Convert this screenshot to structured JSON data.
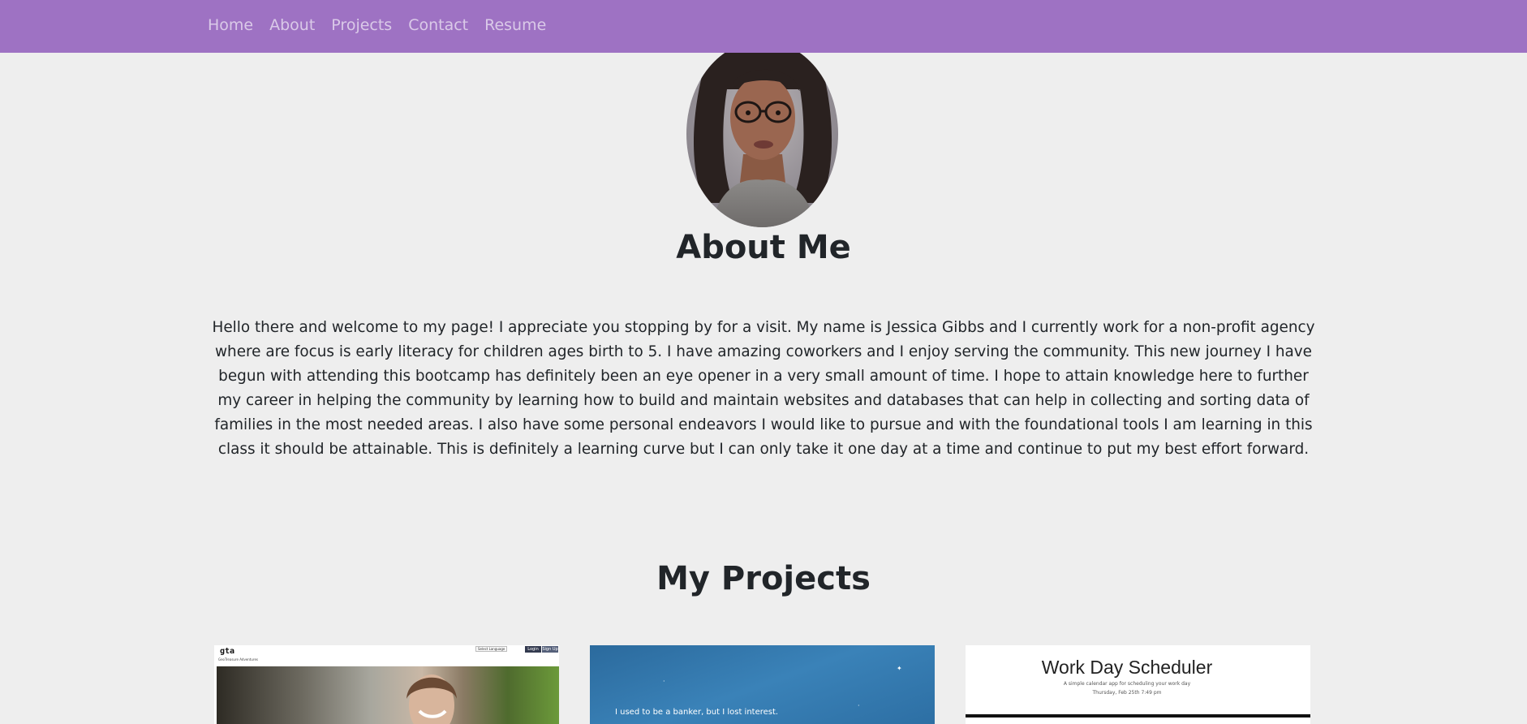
{
  "nav": {
    "items": [
      {
        "label": "Home"
      },
      {
        "label": "About"
      },
      {
        "label": "Projects"
      },
      {
        "label": "Contact"
      },
      {
        "label": "Resume"
      }
    ]
  },
  "colors": {
    "navbar": "#9e72c3",
    "background": "#eeeeee",
    "heading": "#212529"
  },
  "about": {
    "title": "About Me",
    "text": "Hello there and welcome to my page! I appreciate you stopping by for a visit. My name is Jessica Gibbs and I currently work for a non-profit agency where are focus is early literacy for children ages birth to 5. I have amazing coworkers and I enjoy serving the community. This new journey I have begun with attending this bootcamp has definitely been an eye opener in a very small amount of time. I hope to attain knowledge here to further my career in helping the community by learning how to build and maintain websites and databases that can help in collecting and sorting data of families in the most needed areas. I also have some personal endeavors I would like to pursue and with the foundational tools I am learning in this class it should be attainable. This is definitely a learning curve but I can only take it one day at a time and continue to put my best effort forward."
  },
  "projects": {
    "title": "My Projects",
    "cards": [
      {
        "logo": "gta",
        "subtitle": "GeoTreasure Adventures",
        "language": "Select Language",
        "login": "Login",
        "signup": "Sign Up"
      },
      {
        "caption": "I used to be a banker, but I lost interest."
      },
      {
        "title": "Work Day Scheduler",
        "subtitle": "A simple calendar app for scheduling your work day",
        "date": "Thursday, Feb 25th 7:49 pm"
      }
    ]
  }
}
